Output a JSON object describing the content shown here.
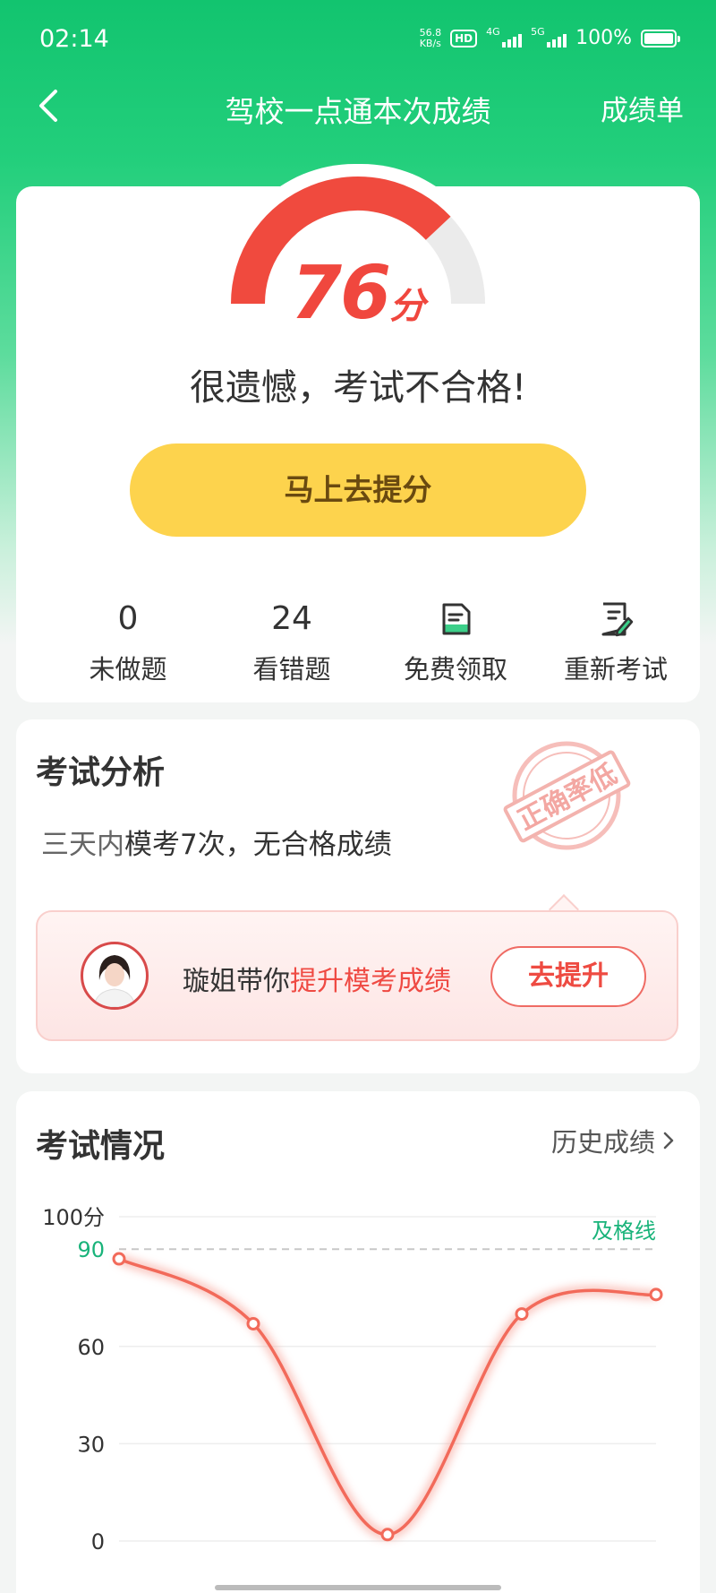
{
  "status_bar": {
    "time": "02:14",
    "net_speed_value": "56.8",
    "net_speed_unit": "KB/s",
    "hd": "HD",
    "signal_1": "4G",
    "signal_2": "5G",
    "battery": "100%"
  },
  "nav": {
    "back_icon": "chevron-left-icon",
    "title": "驾校一点通本次成绩",
    "action": "成绩单"
  },
  "score": {
    "value": "76",
    "unit": "分",
    "max": 100,
    "result_text": "很遗憾，考试不合格!",
    "boost_button": "马上去提分",
    "gauge_fill_color": "#f04a3e",
    "gauge_track_color": "#ebebeb"
  },
  "stats": [
    {
      "value": "0",
      "label": "未做题"
    },
    {
      "value": "24",
      "label": "看错题"
    },
    {
      "icon": "document-icon",
      "label": "免费领取"
    },
    {
      "icon": "edit-document-icon",
      "label": "重新考试"
    }
  ],
  "analysis": {
    "title": "考试分析",
    "text_prefix": "三天内",
    "text_main": "模考7次，无合格成绩",
    "stamp": "正确率低",
    "promo_text_prefix": "璇姐带你",
    "promo_text_highlight": "提升模考成绩",
    "promo_button": "去提升"
  },
  "exam": {
    "title": "考试情况",
    "history_link": "历史成绩"
  },
  "chart_data": {
    "type": "line",
    "y_ticks": [
      "100分",
      "90",
      "60",
      "30",
      "0"
    ],
    "ylim": [
      0,
      100
    ],
    "pass_line": {
      "value": 90,
      "label": "及格线"
    },
    "series": [
      {
        "values": [
          87,
          67,
          2,
          70,
          76
        ]
      }
    ],
    "line_color": "#f26a5a",
    "pass_color": "#19b37a"
  }
}
